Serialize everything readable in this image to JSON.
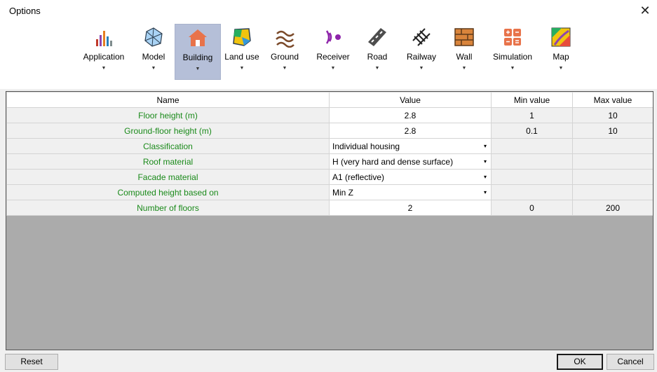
{
  "window": {
    "title": "Options",
    "close_glyph": "✕"
  },
  "toolbar": {
    "arrow_glyph": "▼",
    "items": [
      {
        "label": "Application",
        "icon": "application-icon",
        "active": false
      },
      {
        "label": "Model",
        "icon": "model-icon",
        "active": false
      },
      {
        "label": "Building",
        "icon": "building-icon",
        "active": true
      },
      {
        "label": "Land use",
        "icon": "land-use-icon",
        "active": false
      },
      {
        "label": "Ground",
        "icon": "ground-icon",
        "active": false
      },
      {
        "label": "Receiver",
        "icon": "receiver-icon",
        "active": false
      },
      {
        "label": "Road",
        "icon": "road-icon",
        "active": false
      },
      {
        "label": "Railway",
        "icon": "railway-icon",
        "active": false
      },
      {
        "label": "Wall",
        "icon": "wall-icon",
        "active": false
      },
      {
        "label": "Simulation",
        "icon": "simulation-icon",
        "active": false
      },
      {
        "label": "Map",
        "icon": "map-icon",
        "active": false
      }
    ]
  },
  "grid": {
    "headers": {
      "name": "Name",
      "value": "Value",
      "min": "Min value",
      "max": "Max value"
    },
    "dropdown_glyph": "▾",
    "rows": [
      {
        "name": "Floor height (m)",
        "value": "2.8",
        "min": "1",
        "max": "10",
        "type": "number"
      },
      {
        "name": "Ground-floor height (m)",
        "value": "2.8",
        "min": "0.1",
        "max": "10",
        "type": "number"
      },
      {
        "name": "Classification",
        "value": "Individual housing",
        "min": "",
        "max": "",
        "type": "select"
      },
      {
        "name": "Roof material",
        "value": "H (very hard and dense surface)",
        "min": "",
        "max": "",
        "type": "select"
      },
      {
        "name": "Facade material",
        "value": "A1 (reflective)",
        "min": "",
        "max": "",
        "type": "select"
      },
      {
        "name": "Computed height based on",
        "value": "Min Z",
        "min": "",
        "max": "",
        "type": "select"
      },
      {
        "name": "Number of floors",
        "value": "2",
        "min": "0",
        "max": "200",
        "type": "number"
      }
    ]
  },
  "buttons": {
    "reset": "Reset",
    "ok": "OK",
    "cancel": "Cancel"
  },
  "colors": {
    "name_text": "#1a8a1a",
    "active_tab": "#b5bfd8",
    "empty_grid": "#ababab"
  }
}
